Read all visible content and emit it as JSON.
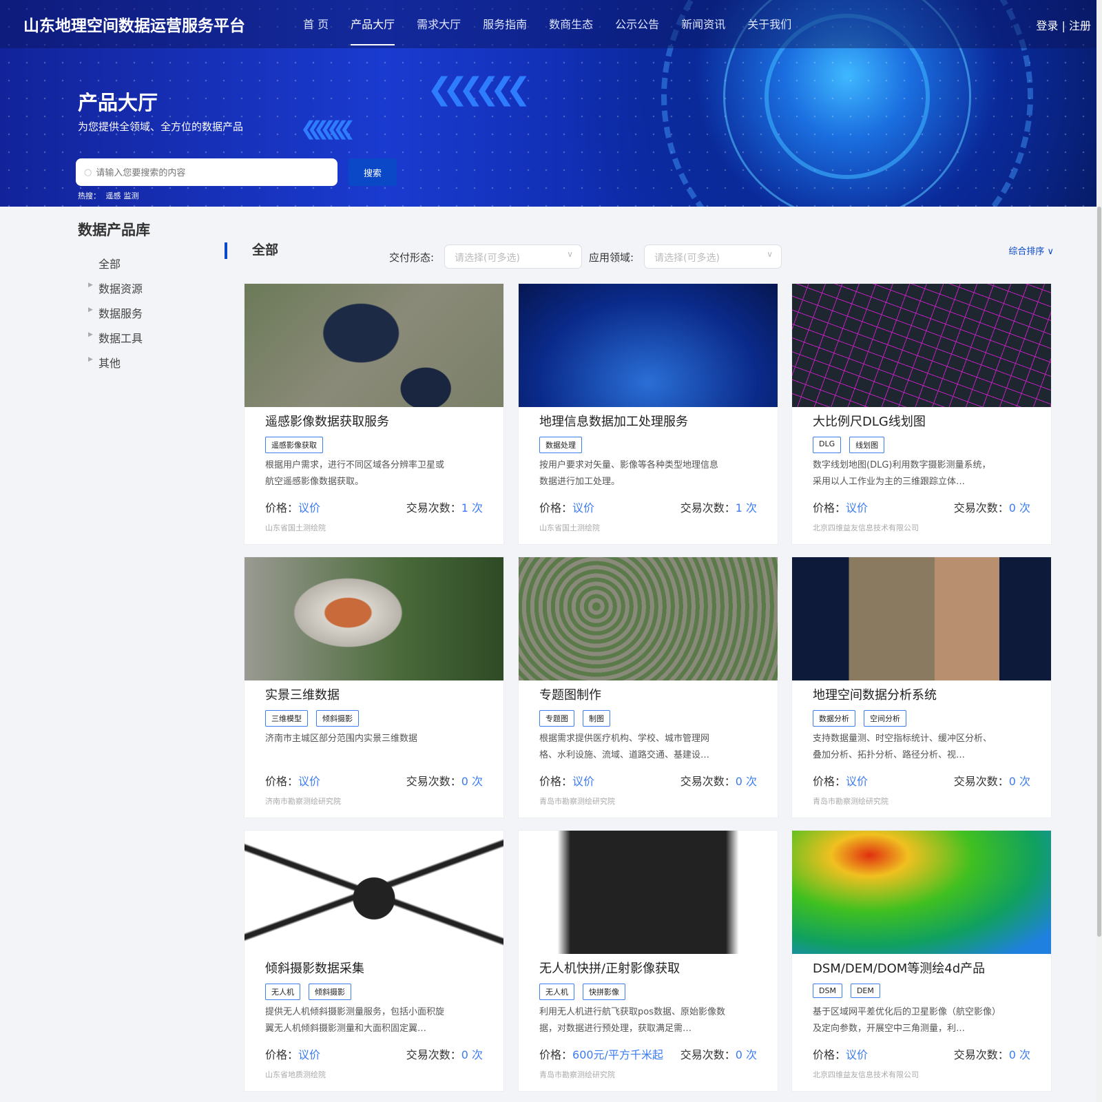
{
  "header": {
    "logo": "山东地理空间数据运营服务平台",
    "nav": [
      "首 页",
      "产品大厅",
      "需求大厅",
      "服务指南",
      "数商生态",
      "公示公告",
      "新闻资讯",
      "关于我们"
    ],
    "active_index": 1,
    "login": "登录",
    "sep": "|",
    "register": "注册"
  },
  "banner": {
    "title": "产品大厅",
    "subtitle": "为您提供全领域、全方位的数据产品",
    "search_placeholder": "请输入您要搜索的内容",
    "search_button": "搜索",
    "hot_label": "热搜：",
    "hot": [
      "遥感",
      "监测"
    ]
  },
  "sidebar": {
    "title": "数据产品库",
    "items": [
      "全部",
      "数据资源",
      "数据服务",
      "数据工具",
      "其他"
    ]
  },
  "filters": {
    "category": "全部",
    "delivery_label": "交付形态:",
    "delivery_placeholder": "请选择(可多选)",
    "field_label": "应用领域:",
    "field_placeholder": "请选择(可多选)",
    "sort": "综合排序"
  },
  "labels": {
    "price": "价格：",
    "trade": "交易次数：",
    "times_suffix": " 次"
  },
  "products": [
    {
      "title": "遥感影像数据获取服务",
      "tags": [
        "遥感影像获取"
      ],
      "desc": "根据用户需求，进行不同区域各分辨率卫星或航空遥感影像数据获取。",
      "price": "议价",
      "trades": "1",
      "org": "山东省国土测绘院",
      "img": "satellite"
    },
    {
      "title": "地理信息数据加工处理服务",
      "tags": [
        "数据处理"
      ],
      "desc": "按用户要求对矢量、影像等各种类型地理信息数据进行加工处理。",
      "price": "议价",
      "trades": "1",
      "org": "山东省国土测绘院",
      "img": "globe"
    },
    {
      "title": "大比例尺DLG线划图",
      "tags": [
        "DLG",
        "线划图"
      ],
      "desc": "数字线划地图(DLG)利用数字摄影测量系统，采用以人工作业为主的三维跟踪立体…",
      "price": "议价",
      "trades": "0",
      "org": "北京四维益友信息技术有限公司",
      "img": "dlg"
    },
    {
      "title": "实景三维数据",
      "tags": [
        "三维模型",
        "倾斜摄影"
      ],
      "desc": "济南市主城区部分范围内实景三维数据",
      "price": "议价",
      "trades": "0",
      "org": "济南市勘察测绘研究院",
      "img": "building"
    },
    {
      "title": "专题图制作",
      "tags": [
        "专题图",
        "制图"
      ],
      "desc": "根据需求提供医疗机构、学校、城市管理网格、水利设施、流域、道路交通、基建设…",
      "price": "议价",
      "trades": "0",
      "org": "青岛市勘察测绘研究院",
      "img": "terrain"
    },
    {
      "title": "地理空间数据分析系统",
      "tags": [
        "数据分析",
        "空间分析"
      ],
      "desc": "支持数据量测、时空指标统计、缓冲区分析、叠加分析、拓扑分析、路径分析、视…",
      "price": "议价",
      "trades": "0",
      "org": "青岛市勘察测绘研究院",
      "img": "dashboard"
    },
    {
      "title": "倾斜摄影数据采集",
      "tags": [
        "无人机",
        "倾斜摄影"
      ],
      "desc": "提供无人机倾斜摄影测量服务，包括小面积旋翼无人机倾斜摄影测量和大面积固定翼…",
      "price": "议价",
      "trades": "0",
      "org": "山东省地质测绘院",
      "img": "drone"
    },
    {
      "title": "无人机快拼/正射影像获取",
      "tags": [
        "无人机",
        "快拼影像"
      ],
      "desc": "利用无人机进行航飞获取pos数据、原始影像数据，对数据进行预处理，获取满足需…",
      "price": "600元/平方千米起",
      "trades": "0",
      "org": "青岛市勘察测绘研究院",
      "img": "camera"
    },
    {
      "title": "DSM/DEM/DOM等测绘4d产品",
      "tags": [
        "DSM",
        "DEM"
      ],
      "desc": "基于区域网平差优化后的卫星影像（航空影像）及定向参数，开展空中三角测量，利…",
      "price": "议价",
      "trades": "0",
      "org": "北京四维益友信息技术有限公司",
      "img": "dem"
    }
  ]
}
